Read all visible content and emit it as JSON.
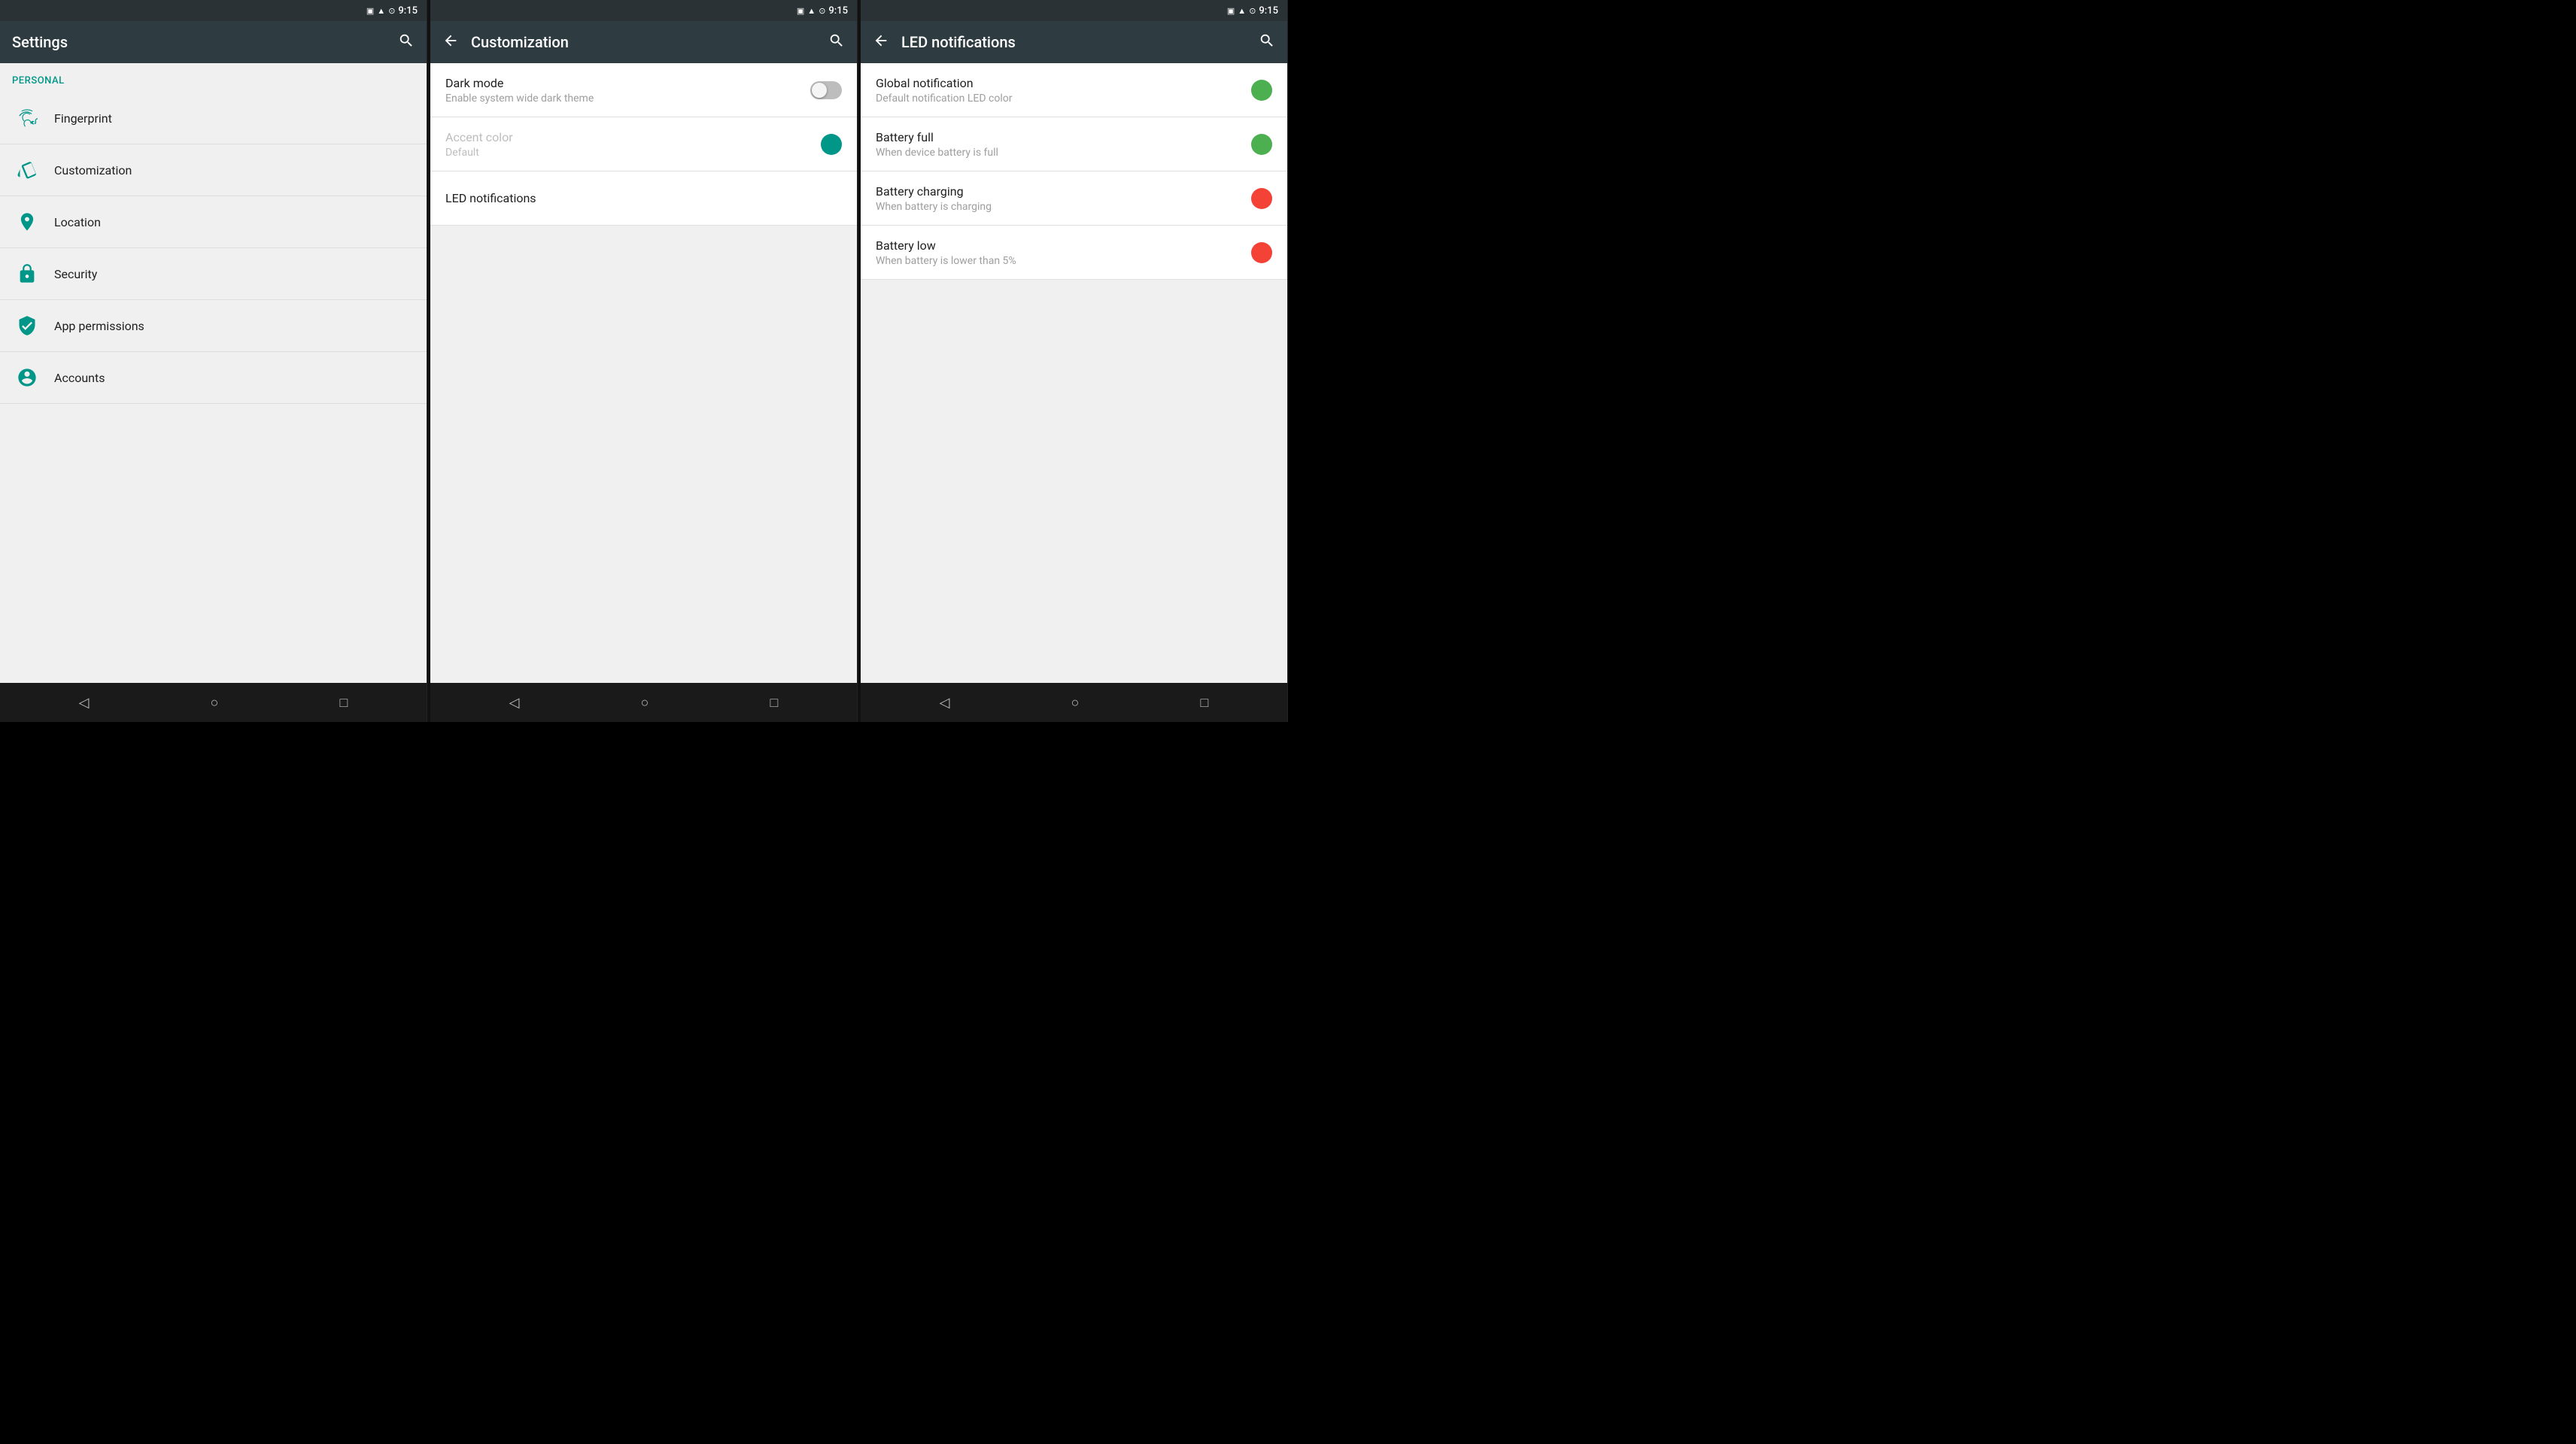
{
  "panels": {
    "settings": {
      "status_bar": {
        "time": "9:15"
      },
      "app_bar": {
        "title": "Settings",
        "search_label": "Search"
      },
      "section_personal": "Personal",
      "items": [
        {
          "id": "fingerprint",
          "label": "Fingerprint",
          "icon": "fingerprint"
        },
        {
          "id": "customization",
          "label": "Customization",
          "icon": "customization"
        },
        {
          "id": "location",
          "label": "Location",
          "icon": "location"
        },
        {
          "id": "security",
          "label": "Security",
          "icon": "security"
        },
        {
          "id": "app-permissions",
          "label": "App permissions",
          "icon": "app-permissions"
        },
        {
          "id": "accounts",
          "label": "Accounts",
          "icon": "accounts"
        }
      ],
      "nav": {
        "back": "◁",
        "home": "○",
        "recents": "□"
      }
    },
    "customization": {
      "status_bar": {
        "time": "9:15"
      },
      "app_bar": {
        "back_label": "Back",
        "title": "Customization",
        "search_label": "Search"
      },
      "items": [
        {
          "id": "dark-mode",
          "title": "Dark mode",
          "subtitle": "Enable system wide dark theme",
          "control": "toggle",
          "enabled": false
        },
        {
          "id": "accent-color",
          "title": "Accent color",
          "subtitle": "Default",
          "control": "dot",
          "disabled": true
        },
        {
          "id": "led-notifications",
          "title": "LED notifications",
          "subtitle": "",
          "control": "none"
        }
      ],
      "nav": {
        "back": "◁",
        "home": "○",
        "recents": "□"
      }
    },
    "led_notifications": {
      "status_bar": {
        "time": "9:15"
      },
      "app_bar": {
        "back_label": "Back",
        "title": "LED notifications",
        "search_label": "Search"
      },
      "items": [
        {
          "id": "global-notification",
          "title": "Global notification",
          "subtitle": "Default notification LED color",
          "dot_color": "green"
        },
        {
          "id": "battery-full",
          "title": "Battery full",
          "subtitle": "When device battery is full",
          "dot_color": "green"
        },
        {
          "id": "battery-charging",
          "title": "Battery charging",
          "subtitle": "When battery is charging",
          "dot_color": "red"
        },
        {
          "id": "battery-low",
          "title": "Battery low",
          "subtitle": "When battery is lower than 5%",
          "dot_color": "red"
        }
      ],
      "nav": {
        "back": "◁",
        "home": "○",
        "recents": "□"
      }
    }
  }
}
